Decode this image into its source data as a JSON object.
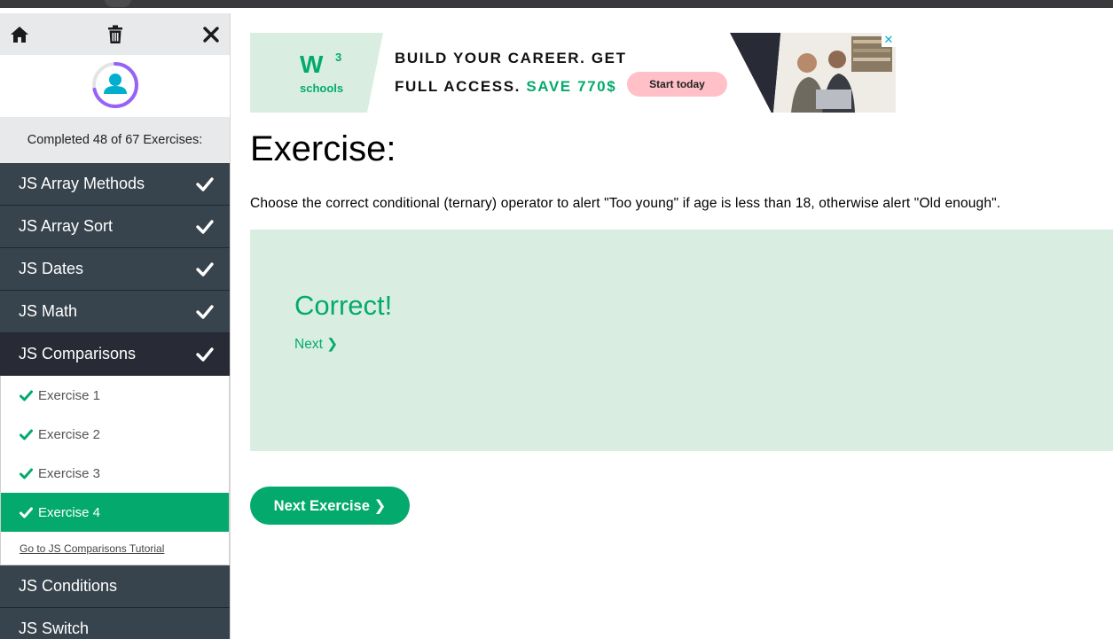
{
  "sidebar": {
    "icons": {
      "home": "home-icon",
      "trash": "trash-icon",
      "close": "close-icon"
    },
    "progress_text": "Completed 48 of 67 Exercises:",
    "progress_fraction": 0.716,
    "topics_before": [
      {
        "label": "JS Array Methods",
        "done": true
      },
      {
        "label": "JS Array Sort",
        "done": true
      },
      {
        "label": "JS Dates",
        "done": true
      },
      {
        "label": "JS Math",
        "done": true
      }
    ],
    "active_topic": {
      "label": "JS Comparisons",
      "done": true
    },
    "exercises": [
      {
        "label": "Exercise 1"
      },
      {
        "label": "Exercise 2"
      },
      {
        "label": "Exercise 3"
      },
      {
        "label": "Exercise 4"
      }
    ],
    "tutorial_link": "Go to JS Comparisons Tutorial",
    "topics_after": [
      {
        "label": "JS Conditions"
      },
      {
        "label": "JS Switch"
      }
    ]
  },
  "ad": {
    "logo_mark": "W",
    "logo_super": "3",
    "logo_sub": "schools",
    "line1": "BUILD YOUR CAREER. GET",
    "line2_prefix": "FULL ACCESS. ",
    "line2_highlight": "SAVE 770$",
    "cta": "Start today",
    "close": "✕"
  },
  "main": {
    "title": "Exercise:",
    "description": "Choose the correct conditional (ternary) operator to alert \"Too young\" if age is less than 18, otherwise alert \"Old enough\".",
    "result_title": "Correct!",
    "next_link": "Next ❯",
    "next_exercise_button": "Next Exercise ❯"
  },
  "colors": {
    "accent": "#04aa6d",
    "sidebar_dark": "#38444d",
    "result_bg": "#d9eee1",
    "cta_pink": "#ffc0c7"
  }
}
